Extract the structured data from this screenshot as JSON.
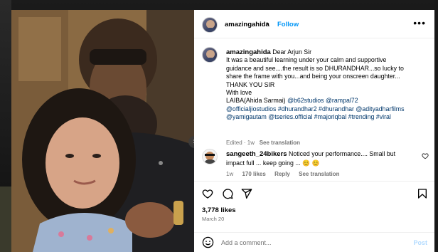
{
  "post": {
    "username": "amazingahida",
    "separator": "•",
    "follow_label": "Follow",
    "more_label": "•••"
  },
  "caption": {
    "username": "amazingahida",
    "lines": [
      " Dear Arjun Sir",
      "It was a beautiful learning under your calm and supportive",
      "guidance and see....the result is so DHURANDHAR...so lucky to",
      "share the frame with you...and being your onscreen daughter...",
      "THANK YOU SIR",
      "With love"
    ],
    "last_lines": {
      "l7_text": "LAIBA(Ahida Sarmai) ",
      "l7_tags": "@b62studios @rampal72",
      "l8_tags": "@officialjiostudios #dhurandhar2 #dhurandhar @adityadharfilms",
      "l9_tags": "@yamigautam @tseries.official #majoriqbal #trending #viral"
    },
    "meta": {
      "edited": "Edited · 1w",
      "see_translation": "See translation"
    }
  },
  "comment": {
    "username": "sangeeth_24bikers",
    "text_line1": " Noticed your performance.... Small but",
    "text_line2": "impact full ... keep going ... 😊 😊",
    "age": "1w",
    "likes": "170 likes",
    "reply": "Reply",
    "see_translation": "See translation"
  },
  "engagement": {
    "likes": "3,778 likes",
    "date": "March 20"
  },
  "add_comment": {
    "placeholder": "Add a comment...",
    "post_label": "Post"
  },
  "photo": {
    "next_label": "›"
  },
  "colors": {
    "link_blue": "#0095f6",
    "tag_blue": "#00376b",
    "muted": "#737373"
  },
  "icons": [
    "heart-icon",
    "comment-icon",
    "share-icon",
    "bookmark-icon",
    "emoji-icon",
    "heart-small-icon",
    "chevron-right-icon"
  ]
}
